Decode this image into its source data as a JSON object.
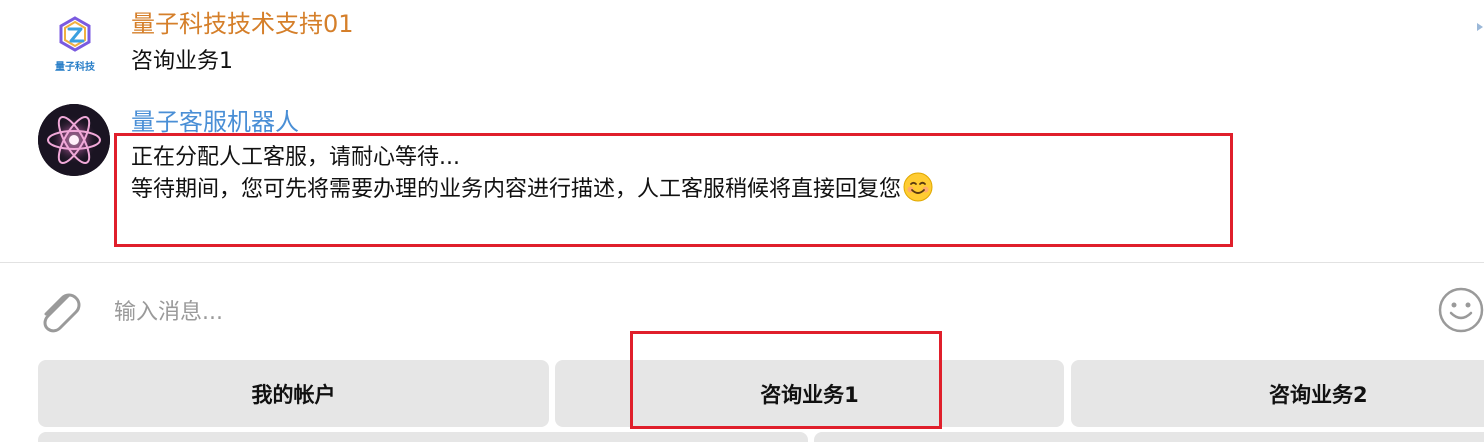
{
  "messages": [
    {
      "sender": "量子科技技术支持01",
      "avatar_icon": "company-logo-icon",
      "avatar_label": "量子科技",
      "lines": [
        "咨询业务1"
      ]
    },
    {
      "sender": "量子客服机器人",
      "avatar_icon": "atom-robot-avatar",
      "lines": [
        "正在分配人工客服，请耐心等待...",
        "等待期间，您可先将需要办理的业务内容进行描述，人工客服稍候将直接回复您"
      ],
      "trailing_icon": "smiling-face-emoji-icon"
    }
  ],
  "composer": {
    "placeholder": "输入消息...",
    "attach_icon": "paperclip-icon",
    "emoji_icon": "emoji-face-icon"
  },
  "keyboard": {
    "row1": [
      "我的帐户",
      "咨询业务1",
      "咨询业务2"
    ]
  },
  "colors": {
    "sender_company": "#d57f2a",
    "sender_bot": "#4a8fd6",
    "highlight": "#e01f2b",
    "button_bg": "#e6e6e6"
  }
}
